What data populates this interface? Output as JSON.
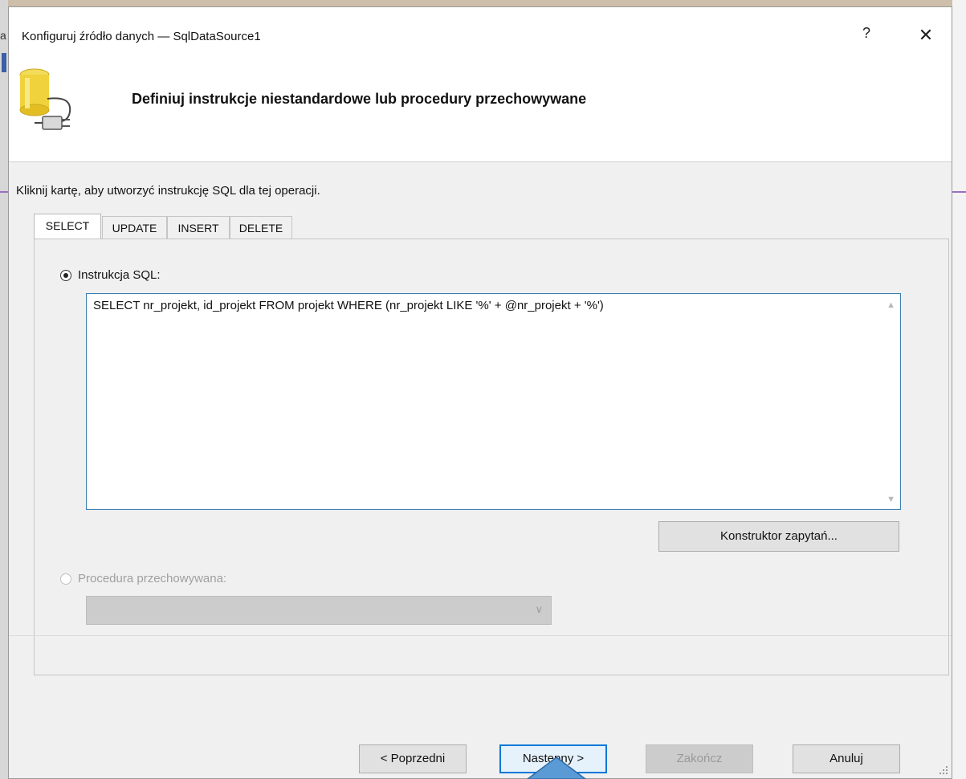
{
  "window": {
    "title": "Konfiguruj źródło danych — SqlDataSource1",
    "help_label": "?",
    "close_label": "✕"
  },
  "header": {
    "title": "Definiuj instrukcje niestandardowe lub procedury przechowywane",
    "icon": "database-plug-icon"
  },
  "instruction": "Kliknij kartę, aby utworzyć instrukcję SQL dla tej operacji.",
  "tabs": [
    {
      "label": "SELECT",
      "active": true
    },
    {
      "label": "UPDATE",
      "active": false
    },
    {
      "label": "INSERT",
      "active": false
    },
    {
      "label": "DELETE",
      "active": false
    }
  ],
  "sql_option": {
    "label": "Instrukcja SQL:",
    "selected": true,
    "text": "SELECT nr_projekt, id_projekt FROM projekt WHERE (nr_projekt LIKE '%' + @nr_projekt + '%')"
  },
  "query_builder_label": "Konstruktor zapytań...",
  "proc_option": {
    "label": "Procedura przechowywana:",
    "selected": false,
    "enabled": false,
    "selected_value": ""
  },
  "footer": {
    "prev_label": "< Poprzedni",
    "next_label": "Następny >",
    "finish_label": "Zakończ",
    "cancel_label": "Anuluj"
  },
  "colors": {
    "focus_blue": "#0078d7",
    "db_yellow": "#f0d23c",
    "background_purple_line": "#9b6fc3"
  }
}
